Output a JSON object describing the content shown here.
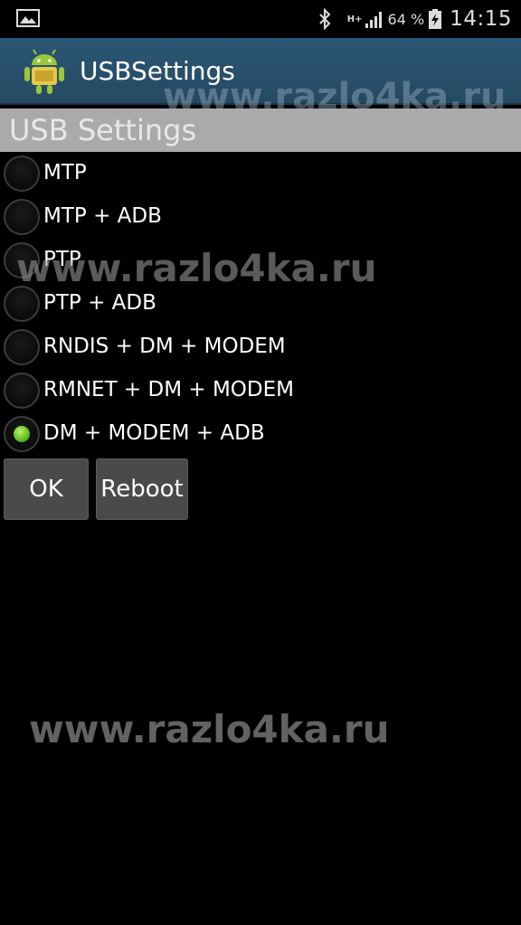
{
  "status_bar": {
    "net_type": "H+",
    "battery_percent": "64 %",
    "time": "14:15",
    "icons": [
      "gallery-icon",
      "bluetooth-icon",
      "signal-icon",
      "battery-charging-icon"
    ]
  },
  "action_bar": {
    "title": "USBSettings",
    "icon": "android-app-icon",
    "color": "#2d5776"
  },
  "section": {
    "title": "USB Settings"
  },
  "options": [
    {
      "label": "MTP",
      "checked": false
    },
    {
      "label": "MTP + ADB",
      "checked": false
    },
    {
      "label": "PTP",
      "checked": false
    },
    {
      "label": "PTP + ADB",
      "checked": false
    },
    {
      "label": "RNDIS + DM + MODEM",
      "checked": false
    },
    {
      "label": "RMNET + DM + MODEM",
      "checked": false
    },
    {
      "label": "DM + MODEM + ADB",
      "checked": true
    }
  ],
  "buttons": {
    "ok": "OK",
    "reboot": "Reboot"
  },
  "watermarks": [
    "www.razlo4ka.ru",
    "www.razlo4ka.ru",
    "www.razlo4ka.ru"
  ],
  "colors": {
    "radio_checked": "#5fbf1d",
    "section_header": "#aaaaaa",
    "background": "#000000"
  }
}
